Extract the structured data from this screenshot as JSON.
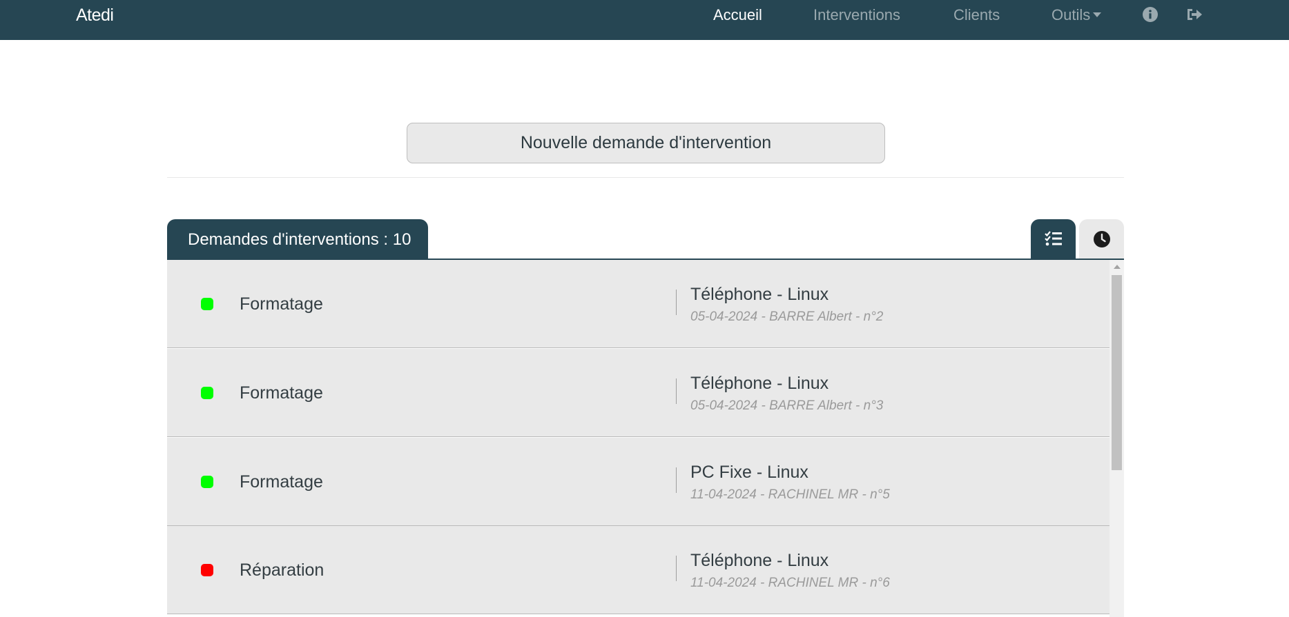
{
  "navbar": {
    "brand": "Atedi",
    "links": [
      {
        "label": "Accueil",
        "active": true
      },
      {
        "label": "Interventions",
        "active": false
      },
      {
        "label": "Clients",
        "active": false
      },
      {
        "label": "Outils",
        "active": false,
        "dropdown": true
      }
    ],
    "icons": [
      "info-icon",
      "logout-icon"
    ]
  },
  "main": {
    "new_request_label": "Nouvelle demande d'intervention",
    "panel_title": "Demandes d'interventions : 10",
    "view_buttons": [
      "list-check-icon",
      "clock-icon"
    ]
  },
  "colors": {
    "primary": "#264653",
    "status_ok": "#00ff00",
    "status_alert": "#ff0000",
    "row_bg": "#e9e9e9"
  },
  "requests": [
    {
      "type": "Formatage",
      "device": "Téléphone - Linux",
      "meta": "05-04-2024 - BARRE Albert - n°2",
      "status": "green"
    },
    {
      "type": "Formatage",
      "device": "Téléphone - Linux",
      "meta": "05-04-2024 - BARRE Albert - n°3",
      "status": "green"
    },
    {
      "type": "Formatage",
      "device": "PC Fixe - Linux",
      "meta": "11-04-2024 - RACHINEL MR - n°5",
      "status": "green"
    },
    {
      "type": "Réparation",
      "device": "Téléphone - Linux",
      "meta": "11-04-2024 - RACHINEL MR - n°6",
      "status": "red"
    }
  ]
}
